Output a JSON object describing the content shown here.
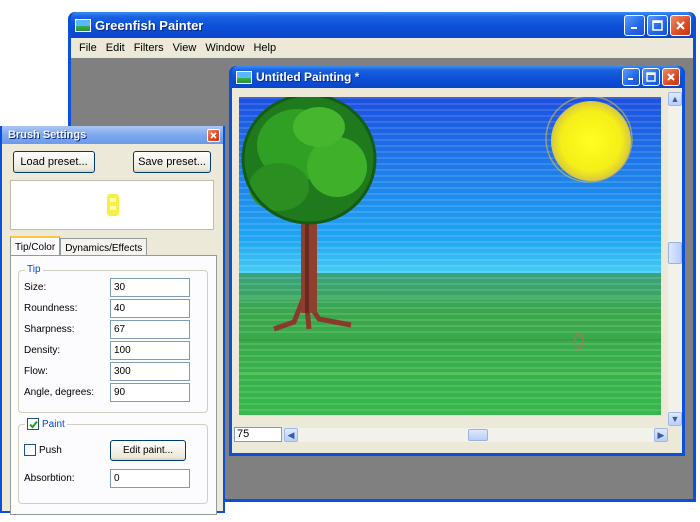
{
  "main_window": {
    "title": "Greenfish Painter",
    "menu": [
      "File",
      "Edit",
      "Filters",
      "View",
      "Window",
      "Help"
    ]
  },
  "child_window": {
    "title": "Untitled Painting *",
    "zoom_value": "75"
  },
  "brush_settings": {
    "title": "Brush Settings",
    "load_preset_label": "Load preset...",
    "save_preset_label": "Save preset...",
    "tabs": [
      "Tip/Color",
      "Dynamics/Effects"
    ],
    "tip_group_label": "Tip",
    "fields": [
      {
        "label": "Size:",
        "value": "30"
      },
      {
        "label": "Roundness:",
        "value": "40"
      },
      {
        "label": "Sharpness:",
        "value": "67"
      },
      {
        "label": "Density:",
        "value": "100"
      },
      {
        "label": "Flow:",
        "value": "300"
      },
      {
        "label": "Angle, degrees:",
        "value": "90"
      }
    ],
    "paint_group_label": "Paint",
    "paint_checked": true,
    "push_label": "Push",
    "push_checked": false,
    "edit_paint_label": "Edit paint...",
    "absorbtion_label": "Absorbtion:",
    "absorbtion_value": "0"
  },
  "colors": {
    "titlebar": "#0a50d8",
    "face": "#ece9d8",
    "mdi_background": "#808080",
    "sky": "#1e8ff0",
    "grass": "#3fae3c",
    "sun": "#f5f01e"
  }
}
